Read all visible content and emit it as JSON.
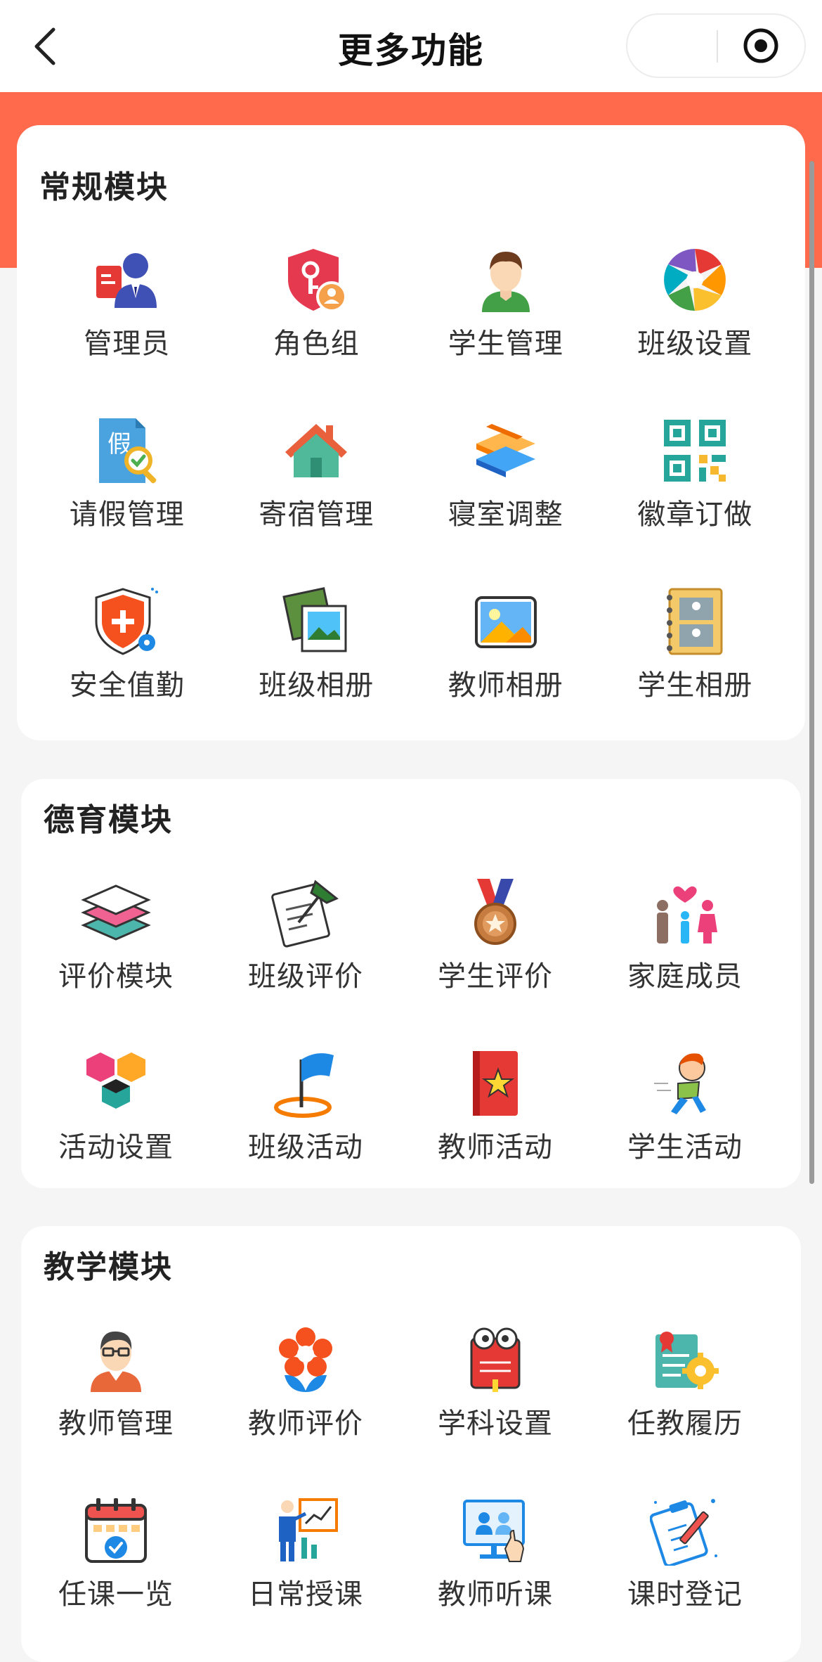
{
  "header": {
    "title": "更多功能"
  },
  "sections": [
    {
      "title": "常规模块",
      "items": [
        {
          "label": "管理员",
          "icon": "admin-icon"
        },
        {
          "label": "角色组",
          "icon": "role-shield-icon"
        },
        {
          "label": "学生管理",
          "icon": "student-avatar-icon"
        },
        {
          "label": "班级设置",
          "icon": "aperture-icon"
        },
        {
          "label": "请假管理",
          "icon": "leave-document-icon"
        },
        {
          "label": "寄宿管理",
          "icon": "house-icon"
        },
        {
          "label": "寝室调整",
          "icon": "layers-ribbon-icon"
        },
        {
          "label": "徽章订做",
          "icon": "qr-code-icon"
        },
        {
          "label": "安全值勤",
          "icon": "safety-shield-icon"
        },
        {
          "label": "班级相册",
          "icon": "photo-stack-icon"
        },
        {
          "label": "教师相册",
          "icon": "landscape-photo-icon"
        },
        {
          "label": "学生相册",
          "icon": "photo-album-icon"
        }
      ]
    },
    {
      "title": "德育模块",
      "items": [
        {
          "label": "评价模块",
          "icon": "stacked-layers-icon"
        },
        {
          "label": "班级评价",
          "icon": "notepad-pin-icon"
        },
        {
          "label": "学生评价",
          "icon": "medal-icon"
        },
        {
          "label": "家庭成员",
          "icon": "family-icon"
        },
        {
          "label": "活动设置",
          "icon": "hexagon-cubes-icon"
        },
        {
          "label": "班级活动",
          "icon": "flag-icon"
        },
        {
          "label": "教师活动",
          "icon": "star-book-icon"
        },
        {
          "label": "学生活动",
          "icon": "running-kid-icon"
        }
      ]
    },
    {
      "title": "教学模块",
      "items": [
        {
          "label": "教师管理",
          "icon": "teacher-icon"
        },
        {
          "label": "教师评价",
          "icon": "flower-icon"
        },
        {
          "label": "学科设置",
          "icon": "book-character-icon"
        },
        {
          "label": "任教履历",
          "icon": "certificate-gear-icon"
        },
        {
          "label": "任课一览",
          "icon": "calendar-check-icon"
        },
        {
          "label": "日常授课",
          "icon": "presentation-icon"
        },
        {
          "label": "教师听课",
          "icon": "video-class-icon"
        },
        {
          "label": "课时登记",
          "icon": "clipboard-pen-icon"
        }
      ]
    }
  ],
  "colors": {
    "banner": "#ff6a4d",
    "card": "#ffffff",
    "background": "#f5f5f5"
  }
}
